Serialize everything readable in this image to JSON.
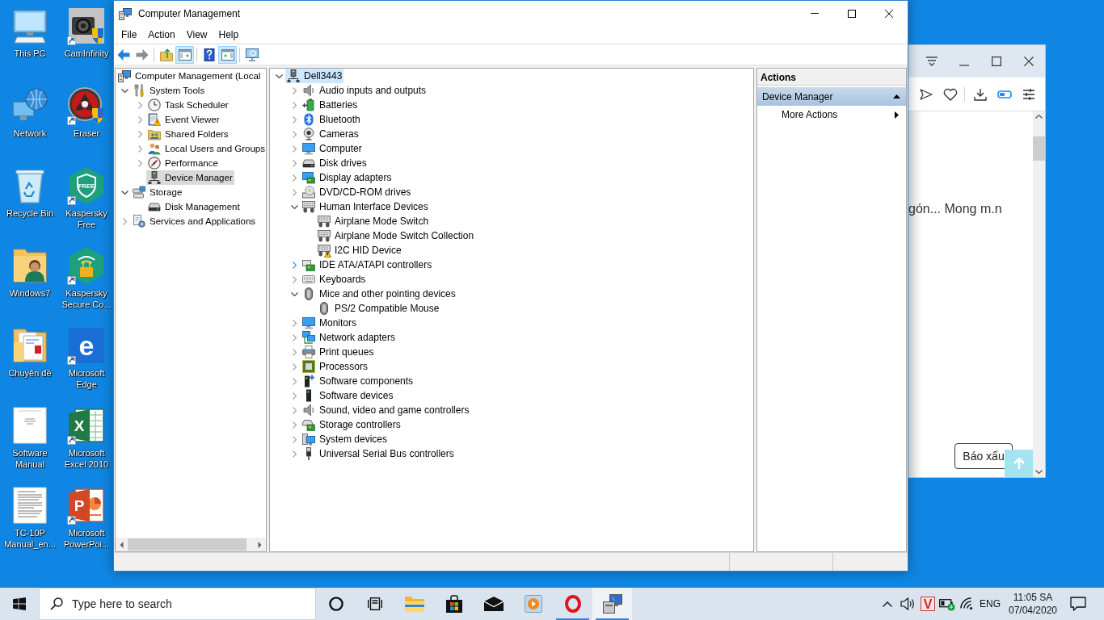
{
  "desktop_icons": [
    {
      "label": "This PC",
      "shortcut": false
    },
    {
      "label": "Network",
      "shortcut": false
    },
    {
      "label": "Recycle Bin",
      "shortcut": false
    },
    {
      "label": "Windows7",
      "shortcut": false
    },
    {
      "label": "Chuyên đề",
      "shortcut": false
    },
    {
      "label": "Software Manual",
      "shortcut": false
    },
    {
      "label": "TC-10P Manual_en...",
      "shortcut": false
    },
    {
      "label": "CamInfinity",
      "shortcut": true
    },
    {
      "label": "Eraser",
      "shortcut": true
    },
    {
      "label": "Kaspersky Free",
      "shortcut": true,
      "logo_text": "FREE"
    },
    {
      "label": "Kaspersky Secure Co...",
      "shortcut": true
    },
    {
      "label": "Microsoft Edge",
      "shortcut": true,
      "logo_text": "e"
    },
    {
      "label": "Microsoft Excel 2010",
      "shortcut": true,
      "logo_text": "X"
    },
    {
      "label": "Microsoft PowerPoi...",
      "shortcut": true,
      "logo_text": "P"
    }
  ],
  "browser": {
    "visible_text": "gón... Mong m.n",
    "report_button": "Báo xấu"
  },
  "window": {
    "title": "Computer Management",
    "menu": [
      "File",
      "Action",
      "View",
      "Help"
    ],
    "toolbar": [
      {
        "disabled": false,
        "pressed": false
      },
      {
        "disabled": true,
        "pressed": false
      },
      {
        "disabled": false,
        "pressed": false
      },
      {
        "disabled": false,
        "pressed": true
      },
      {
        "disabled": false,
        "pressed": false
      },
      {
        "disabled": false,
        "pressed": true
      },
      {
        "disabled": false,
        "pressed": false
      }
    ],
    "console_tree": [
      {
        "label": "Computer Management (Local",
        "selected": false,
        "children": [
          {
            "label": "System Tools",
            "selected": false,
            "expanded": true,
            "children": [
              {
                "label": "Task Scheduler",
                "selected": false,
                "expanded": false
              },
              {
                "label": "Event Viewer",
                "selected": false,
                "expanded": false
              },
              {
                "label": "Shared Folders",
                "selected": false,
                "expanded": false
              },
              {
                "label": "Local Users and Groups",
                "selected": false,
                "expanded": false
              },
              {
                "label": "Performance",
                "selected": false,
                "expanded": false
              },
              {
                "label": "Device Manager",
                "selected": true
              }
            ]
          },
          {
            "label": "Storage",
            "selected": false,
            "expanded": true,
            "children": [
              {
                "label": "Disk Management",
                "selected": false
              }
            ]
          },
          {
            "label": "Services and Applications",
            "selected": false,
            "expanded": false
          }
        ]
      }
    ],
    "device_tree": [
      {
        "label": "Dell3443",
        "selected": true,
        "expanded": true,
        "children": [
          {
            "label": "Audio inputs and outputs",
            "selected": false,
            "expanded": false,
            "hovered": false
          },
          {
            "label": "Batteries",
            "selected": false,
            "expanded": false,
            "hovered": false
          },
          {
            "label": "Bluetooth",
            "selected": false,
            "expanded": false,
            "hovered": false
          },
          {
            "label": "Cameras",
            "selected": false,
            "expanded": false,
            "hovered": false
          },
          {
            "label": "Computer",
            "selected": false,
            "expanded": false,
            "hovered": false
          },
          {
            "label": "Disk drives",
            "selected": false,
            "expanded": false,
            "hovered": false
          },
          {
            "label": "Display adapters",
            "selected": false,
            "expanded": false,
            "hovered": false
          },
          {
            "label": "DVD/CD-ROM drives",
            "selected": false,
            "expanded": false,
            "hovered": false
          },
          {
            "label": "Human Interface Devices",
            "selected": false,
            "expanded": true,
            "hovered": false,
            "children": [
              {
                "label": "Airplane Mode Switch",
                "selected": false,
                "warning": false
              },
              {
                "label": "Airplane Mode Switch Collection",
                "selected": false,
                "warning": false
              },
              {
                "label": "I2C HID Device",
                "selected": false,
                "warning": true
              }
            ]
          },
          {
            "label": "IDE ATA/ATAPI controllers",
            "selected": false,
            "expanded": false,
            "hovered": true
          },
          {
            "label": "Keyboards",
            "selected": false,
            "expanded": false,
            "hovered": false
          },
          {
            "label": "Mice and other pointing devices",
            "selected": false,
            "expanded": true,
            "hovered": false,
            "children": [
              {
                "label": "PS/2 Compatible Mouse",
                "selected": false,
                "warning": false
              }
            ]
          },
          {
            "label": "Monitors",
            "selected": false,
            "expanded": false,
            "hovered": false
          },
          {
            "label": "Network adapters",
            "selected": false,
            "expanded": false,
            "hovered": false
          },
          {
            "label": "Print queues",
            "selected": false,
            "expanded": false,
            "hovered": false
          },
          {
            "label": "Processors",
            "selected": false,
            "expanded": false,
            "hovered": false
          },
          {
            "label": "Software components",
            "selected": false,
            "expanded": false,
            "hovered": false
          },
          {
            "label": "Software devices",
            "selected": false,
            "expanded": false,
            "hovered": false
          },
          {
            "label": "Sound, video and game controllers",
            "selected": false,
            "expanded": false,
            "hovered": false
          },
          {
            "label": "Storage controllers",
            "selected": false,
            "expanded": false,
            "hovered": false
          },
          {
            "label": "System devices",
            "selected": false,
            "expanded": false,
            "hovered": false
          },
          {
            "label": "Universal Serial Bus controllers",
            "selected": false,
            "expanded": false,
            "hovered": false
          }
        ]
      }
    ],
    "actions": {
      "title": "Actions",
      "groups": [
        {
          "label": "Device Manager",
          "expanded": true,
          "items": [
            "More Actions"
          ]
        }
      ]
    }
  },
  "taskbar": {
    "search": {
      "placeholder": "Type here to search"
    },
    "apps": [
      {
        "running": false,
        "selected": false
      },
      {
        "running": false,
        "selected": false
      },
      {
        "running": false,
        "selected": false
      },
      {
        "running": false,
        "selected": false
      },
      {
        "running": true,
        "selected": false
      },
      {
        "running": true,
        "selected": true
      }
    ],
    "tray": {
      "app_logo_text": "V",
      "language": "ENG",
      "time": "11:05 SA",
      "date": "07/04/2020"
    }
  }
}
